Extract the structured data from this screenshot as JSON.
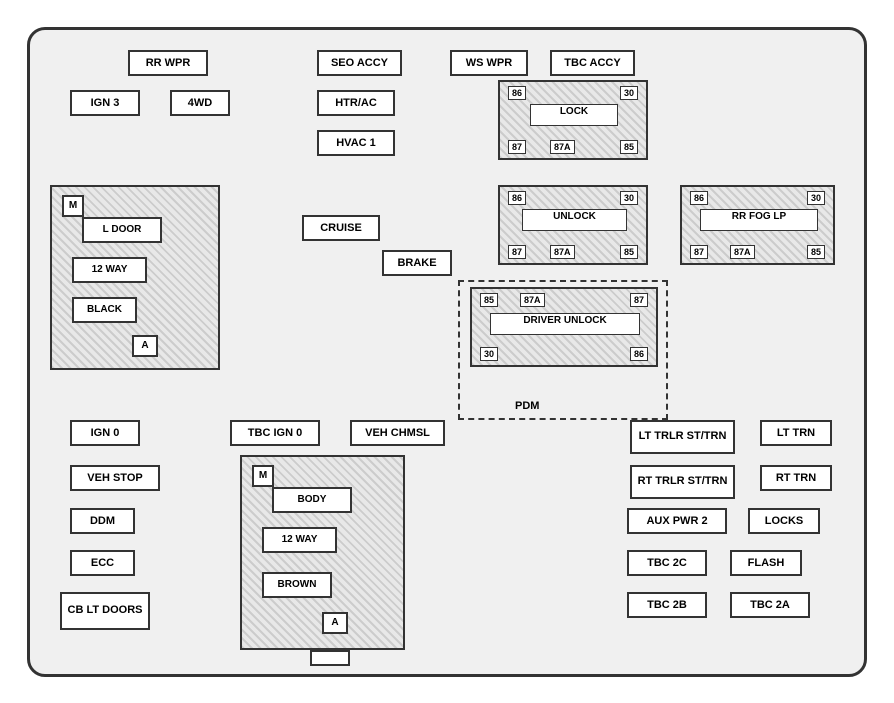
{
  "fuses": {
    "rr_wpr": "RR WPR",
    "ign3": "IGN 3",
    "four_wd": "4WD",
    "seo_accy": "SEO ACCY",
    "ws_wpr": "WS WPR",
    "tbc_accy": "TBC ACCY",
    "htr_ac": "HTR/AC",
    "hvac1": "HVAC 1",
    "cruise": "CRUISE",
    "brake": "BRAKE",
    "ign0": "IGN 0",
    "tbc_ign0": "TBC IGN 0",
    "veh_chmsl": "VEH CHMSL",
    "veh_stop": "VEH STOP",
    "ddm": "DDM",
    "ecc": "ECC",
    "cb_lt_doors": "CB\nLT DOORS",
    "lt_trlr_st_trn": "LT TRLR\nST/TRN",
    "lt_trn": "LT TRN",
    "rt_trlr_st_trn": "RT TRLR\nST/TRN",
    "rt_trn": "RT TRN",
    "aux_pwr2": "AUX PWR 2",
    "locks": "LOCKS",
    "tbc_2c": "TBC 2C",
    "flash": "FLASH",
    "tbc_2b": "TBC 2B",
    "tbc_2a": "TBC 2A"
  },
  "relay_pins": {
    "p86": "86",
    "p87": "87",
    "p87a": "87A",
    "p85": "85",
    "p30": "30"
  },
  "relay_names": {
    "lock": "LOCK",
    "unlock": "UNLOCK",
    "rr_fog_lp": "RR FOG LP",
    "driver_unlock": "DRIVER UNLOCK"
  },
  "blocks": {
    "l_door": {
      "title": "L DOOR",
      "m": "M",
      "way12": "12 WAY",
      "black": "BLACK",
      "a": "A"
    },
    "r_door": {
      "title": "BODY",
      "m": "M",
      "way12": "12 WAY",
      "brown": "BROWN",
      "a": "A"
    }
  },
  "pdm": "PDM"
}
